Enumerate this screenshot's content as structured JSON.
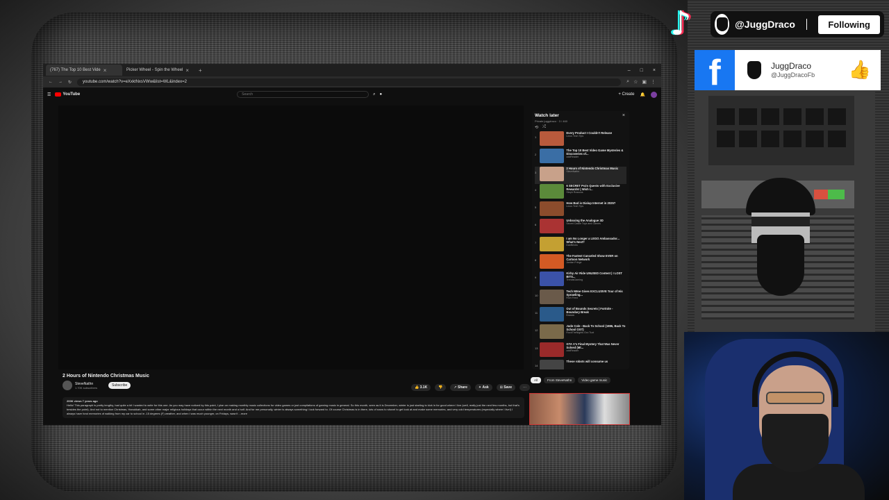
{
  "overlay": {
    "tiktok_handle": "@JuggDraco",
    "follow_label": "Following",
    "facebook": {
      "name": "JuggDraco",
      "handle": "@JuggDracoFb"
    }
  },
  "browser": {
    "tabs": [
      {
        "label": "(767) The Top 10 Best Vide",
        "active": true
      },
      {
        "label": "Picker Wheel - Spin the Wheel",
        "active": false
      }
    ],
    "url": "youtube.com/watch?v=eXxktNxsVWw&list=WL&index=2"
  },
  "youtube": {
    "logo": "YouTube",
    "search_placeholder": "Search",
    "create_label": "+ Create",
    "video": {
      "title": "2 Hours of Nintendo Christmas Music",
      "channel": "SteveNathn",
      "subscribers": "1.70K subscribers",
      "subscribe_label": "Subscribe",
      "likes": "3.1K",
      "share_label": "Share",
      "ask_label": "Ask",
      "save_label": "Save",
      "views_line": "200K views  7 years ago",
      "description": "Hello! This paragraph is pretty lengthy, had quite a bit I wanted to write for this one. As you may have noticed by this point, I plan on making monthly music collections for video games or just compilations of gaming music in general. So this month, seen as it is December, winter is just starting to kick in for good where I live (well, really just the next few months, but that's besides the point). And not to mention Christmas, Hanukkah, and some other major religious holidays that occur within the next month and a half. And for me personally, winter is always something I look forward to. Of course Christmas is in there, lots of snow to shovel to get look at and make some memories, and very cold temperatures (especially where I live!) I always have fond memories of walking from my car to school in -15 degrees (F) weather, and when I was much younger, on Fridays, wasn't ...more"
    },
    "playlist": {
      "title": "Watch later",
      "meta": "Private  juggdraco  ·  3 / 460",
      "items": [
        {
          "n": "1",
          "title": "Every Product I Couldn't Release",
          "channel": "Linus Tech Tips",
          "color": "#b85a3c"
        },
        {
          "n": "2",
          "title": "The Top 10 Best Video Game Mysteries & Discoveries of...",
          "channel": "oddReader",
          "color": "#3a6ea5"
        },
        {
          "n": "3",
          "title": "2 Hours of Nintendo Christmas Music",
          "channel": "SteveNathn",
          "color": "#c8a18a",
          "active": true
        },
        {
          "n": "4",
          "title": "6 SECRET PvZs Quests with Exclusive Rewards! | Wish I...",
          "channel": "Steph Rosscos",
          "color": "#5b8a3a"
        },
        {
          "n": "5",
          "title": "How Bad is Dialup Internet in 2025?",
          "channel": "Linus Tech Tips",
          "color": "#8c4c2c"
        },
        {
          "n": "6",
          "title": "Unboxing the Analogue 3D",
          "channel": "Secret Castle Toys and Games",
          "color": "#a33"
        },
        {
          "n": "7",
          "title": "I am No Longer a LEGO Ambassador... What's Next?",
          "channel": "DanBricks",
          "color": "#c4a032"
        },
        {
          "n": "8",
          "title": "The Fastest Canceled Show EVER on Cartoon Network",
          "channel": "Jordan Fringe",
          "color": "#d35a24"
        },
        {
          "n": "9",
          "title": "Kirby Air Ride UNUSED Content | I LOST BITS...",
          "channel": "TrendsGaming",
          "color": "#3b52a8"
        },
        {
          "n": "10",
          "title": "Tech N9ne Gives EXCLUSIVE Tour of His Sprawling...",
          "channel": "Rich Feed",
          "color": "#6a5a4a"
        },
        {
          "n": "11",
          "title": "Out of Bounds Secrets | Fortnite - Boundary Break",
          "channel": "Brassic",
          "color": "#2a5a8a"
        },
        {
          "n": "12",
          "title": "Jude Cole - Back To School (1986, Back To School OST)",
          "channel": "RockTheNights Gxx Tuxt",
          "color": "#7a6a4a"
        },
        {
          "n": "13",
          "title": "GTA V's Final Mystery That Was Never Solved (Mt...",
          "channel": "oddReader",
          "color": "#9a2a2a"
        },
        {
          "n": "14",
          "title": "These robots will consume us",
          "channel": "",
          "color": "#444"
        }
      ]
    },
    "chips": [
      "All",
      "From SteveNathn",
      "Video game music"
    ]
  }
}
